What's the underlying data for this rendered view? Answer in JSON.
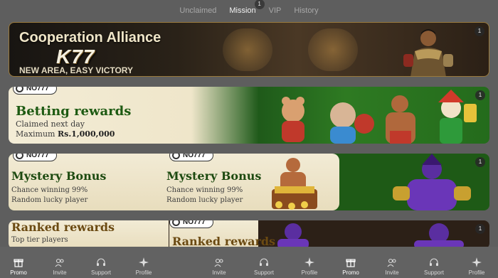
{
  "tabs": [
    {
      "label": "Unclaimed"
    },
    {
      "label": "Mission",
      "badge": "1"
    },
    {
      "label": "VIP"
    },
    {
      "label": "History"
    }
  ],
  "banners": [
    {
      "title": "Cooperation Alliance",
      "logo": "K77",
      "subtitle": "NEW AREA, EASY VICTORY",
      "badge": "1"
    },
    {
      "brand": "NO777",
      "title": "Betting rewards",
      "line1": "Claimed next day",
      "line2_prefix": "Maximum",
      "line2_amount": "Rs.1,000,000",
      "badge": "1"
    },
    {
      "brand": "NO777",
      "title": "Mystery Bonus",
      "line1": "Chance winning 99%",
      "line2": "Random lucky player",
      "dup_brand": "NO777",
      "dup_title": "Mystery Bonus",
      "dup_line1": "Chance winning 99%",
      "dup_line2": "Random lucky player",
      "badge": "1"
    },
    {
      "brand": "NO777",
      "title": "Ranked rewards",
      "line1": "Top tier players",
      "dup_brand": "NO777",
      "dup_title": "Ranked rewards",
      "badge": "1"
    }
  ],
  "nav": [
    {
      "label": "Promo",
      "icon": "gift-icon",
      "active": true
    },
    {
      "label": "Invite",
      "icon": "users-icon"
    },
    {
      "label": "Support",
      "icon": "headset-icon"
    },
    {
      "label": "Profile",
      "icon": "sparkle-icon"
    },
    {
      "label": "Invite",
      "icon": "users-icon"
    },
    {
      "label": "Support",
      "icon": "headset-icon"
    },
    {
      "label": "Profile",
      "icon": "sparkle-icon"
    },
    {
      "label": "Promo",
      "icon": "gift-icon",
      "active": true
    },
    {
      "label": "Invite",
      "icon": "users-icon"
    },
    {
      "label": "Support",
      "icon": "headset-icon"
    },
    {
      "label": "Profile",
      "icon": "sparkle-icon"
    }
  ]
}
